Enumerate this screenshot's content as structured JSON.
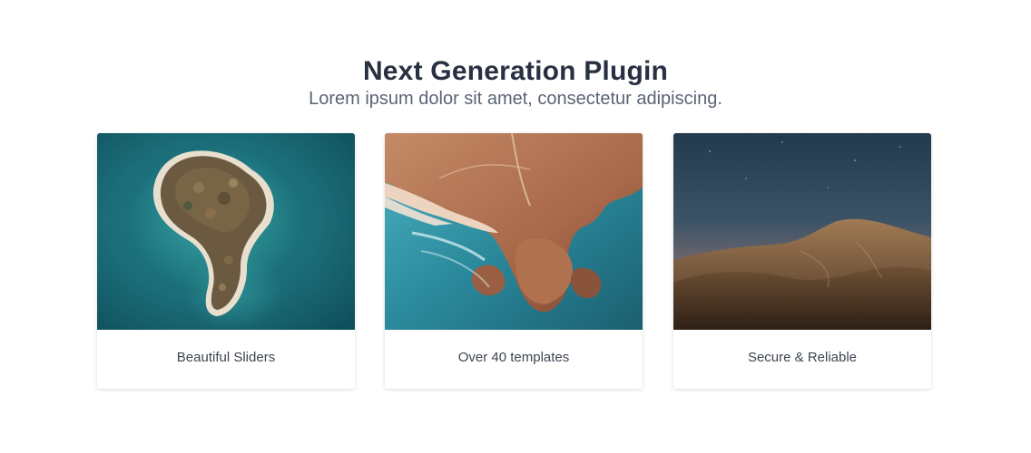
{
  "section": {
    "title": "Next Generation Plugin",
    "subtitle": "Lorem ipsum dolor sit amet, consectetur adipiscing."
  },
  "cards": [
    {
      "label": "Beautiful Sliders",
      "image": "aerial-island-photo"
    },
    {
      "label": "Over 40 templates",
      "image": "aerial-coastline-photo"
    },
    {
      "label": "Secure & Reliable",
      "image": "desert-hills-night-photo"
    }
  ],
  "colors": {
    "title": "#283042",
    "subtitle": "#5b6474",
    "card_label": "#3e4452",
    "background": "#ffffff"
  }
}
